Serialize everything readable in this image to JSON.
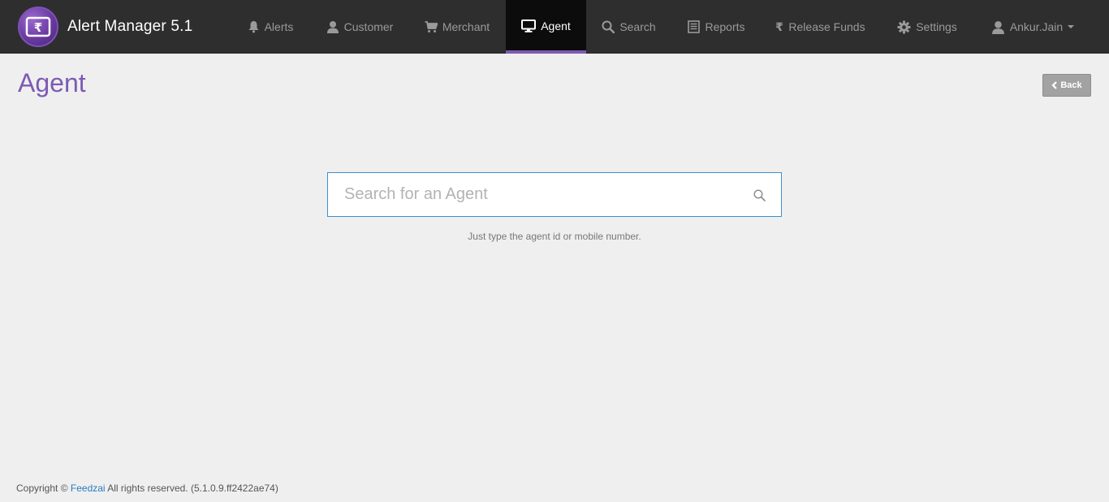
{
  "app": {
    "title": "Alert Manager 5.1"
  },
  "nav": {
    "items": [
      {
        "label": "Alerts",
        "icon": "bell-icon"
      },
      {
        "label": "Customer",
        "icon": "user-icon"
      },
      {
        "label": "Merchant",
        "icon": "cart-icon"
      },
      {
        "label": "Agent",
        "icon": "monitor-icon",
        "active": true
      },
      {
        "label": "Search",
        "icon": "search-icon"
      },
      {
        "label": "Reports",
        "icon": "list-icon"
      },
      {
        "label": "Release Funds",
        "icon": "rupee-icon"
      },
      {
        "label": "Settings",
        "icon": "gear-icon"
      }
    ],
    "user": {
      "label": "Ankur.Jain",
      "icon": "user-icon"
    }
  },
  "page": {
    "title": "Agent",
    "back_label": "Back"
  },
  "search": {
    "placeholder": "Search for an Agent",
    "value": "",
    "hint": "Just type the agent id or mobile number."
  },
  "footer": {
    "prefix": "Copyright ©",
    "link": "Feedzai",
    "suffix": "All rights reserved. (5.1.0.9.ff2422ae74)"
  },
  "colors": {
    "topbar": "#2e2e2e",
    "accent": "#7d5bb3",
    "active_tab": "#0c0c0c",
    "search_border": "#3a8fd0",
    "link": "#2a7ac0"
  }
}
